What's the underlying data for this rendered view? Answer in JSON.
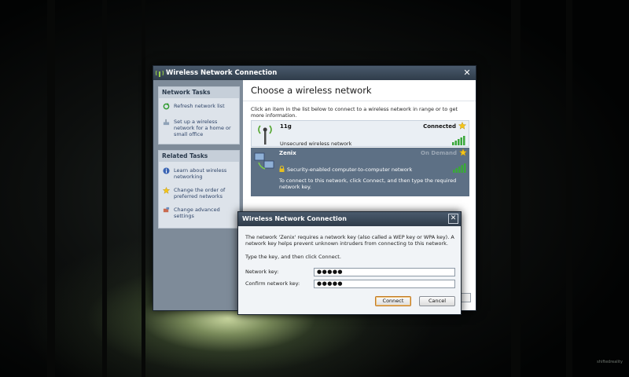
{
  "main_window": {
    "title": "Wireless Network Connection",
    "close_label": "✕",
    "left": {
      "network_tasks": {
        "heading": "Network Tasks",
        "items": [
          {
            "label": "Refresh network list",
            "icon": "refresh-icon"
          },
          {
            "label": "Set up a wireless network for a home or small office",
            "icon": "wireless-setup-icon"
          }
        ]
      },
      "related_tasks": {
        "heading": "Related Tasks",
        "items": [
          {
            "label": "Learn about wireless networking",
            "icon": "info-icon"
          },
          {
            "label": "Change the order of preferred networks",
            "icon": "star-icon"
          },
          {
            "label": "Change advanced settings",
            "icon": "settings-icon"
          }
        ]
      }
    },
    "right": {
      "title": "Choose a wireless network",
      "instructions": "Click an item in the list below to connect to a wireless network in range or to get more information.",
      "networks": [
        {
          "name": "11g",
          "state": "Connected",
          "description": "Unsecured wireless network",
          "signal_bars": 5
        },
        {
          "name": "Zenix",
          "state": "On Demand",
          "description": "Security-enabled computer-to-computer network",
          "signal_bars": 5,
          "message": "To connect to this network, click Connect, and then type the required network key."
        }
      ]
    }
  },
  "dialog": {
    "title": "Wireless Network Connection",
    "close_label": "✕",
    "message": "The network 'Zenix' requires a network key (also called a WEP key or WPA key). A network key helps prevent unknown intruders from connecting to this network.",
    "instruction": "Type the key, and then click Connect.",
    "network_key_label": "Network key:",
    "network_key_value": "●●●●●",
    "confirm_key_label": "Confirm network key:",
    "confirm_key_value": "●●●●●",
    "connect_label": "Connect",
    "cancel_label": "Cancel"
  },
  "watermark": "shiftedreality",
  "colors": {
    "titlebar": "#3d4b5b",
    "left_pane": "#7e8b99",
    "selected_row": "#5d7085",
    "signal_green": "#3aa83a",
    "star": "#f5c518"
  }
}
